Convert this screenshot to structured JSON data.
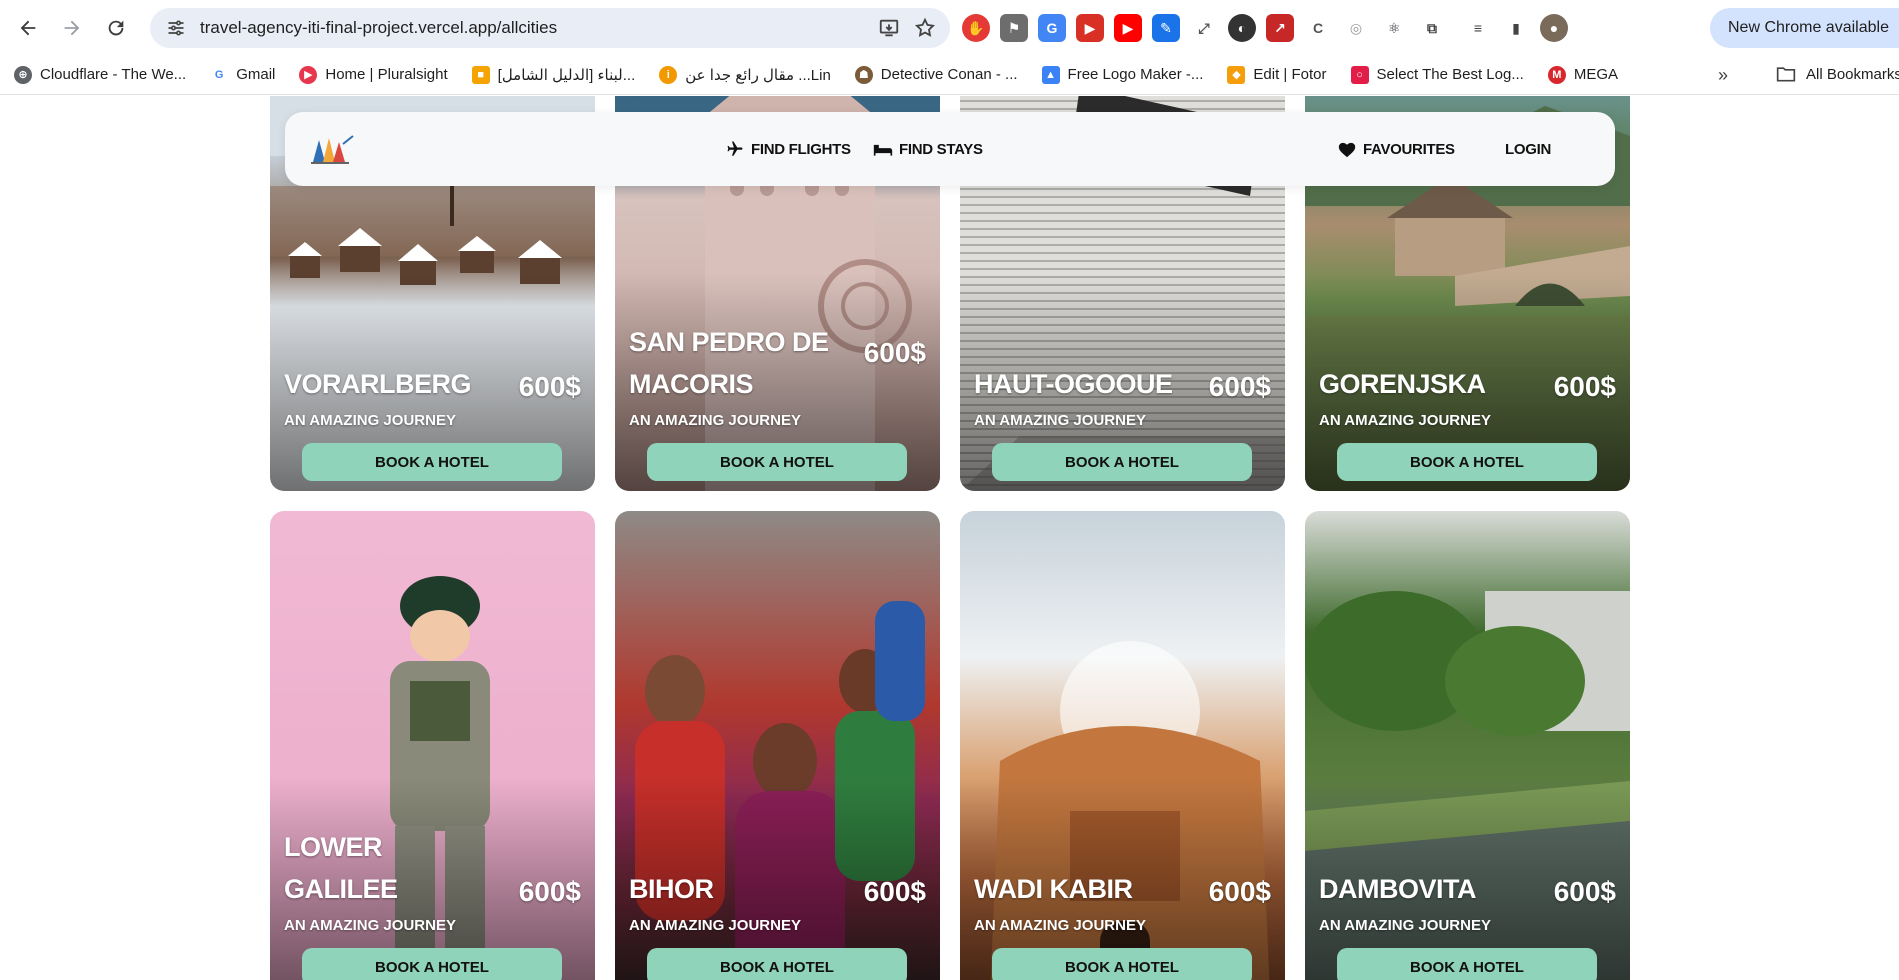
{
  "browser": {
    "url": "travel-agency-iti-final-project.vercel.app/allcities",
    "new_chrome_label": "New Chrome available",
    "bookmarks": [
      {
        "label": "Cloudflare - The We...",
        "color": "#5f6368"
      },
      {
        "label": "Gmail",
        "color": "#4285f4"
      },
      {
        "label": "Home | Pluralsight",
        "color": "#e8364f"
      },
      {
        "label": "[الدليل الشامل] لبناء...",
        "color": "#f4a300"
      },
      {
        "label": "مقال رائع جدا عن ...Lin",
        "color": "#f29900"
      },
      {
        "label": "Detective Conan - ...",
        "color": "#7b5b3a"
      },
      {
        "label": "Free Logo Maker -...",
        "color": "#3b82f6"
      },
      {
        "label": "Edit | Fotor",
        "color": "#f59e0b"
      },
      {
        "label": "Select The Best Log...",
        "color": "#e11d48"
      },
      {
        "label": "MEGA",
        "color": "#d9272e"
      }
    ],
    "more_bookmarks": "»",
    "all_bookmarks_label": "All Bookmarks"
  },
  "nav": {
    "flights": "Find Flights",
    "stays": "Find Stays",
    "favourites": "Favourites",
    "login": "Login"
  },
  "cards": [
    {
      "city": "Vorarlberg",
      "tagline": "An amazing journey",
      "price": "600$",
      "button": "Book a hotel"
    },
    {
      "city": "San Pedro de Macoris",
      "tagline": "An amazing journey",
      "price": "600$",
      "button": "Book a hotel"
    },
    {
      "city": "Haut-Ogooue",
      "tagline": "An amazing journey",
      "price": "600$",
      "button": "Book a hotel"
    },
    {
      "city": "Gorenjska",
      "tagline": "An amazing journey",
      "price": "600$",
      "button": "Book a hotel"
    },
    {
      "city": "Lower Galilee",
      "tagline": "An amazing journey",
      "price": "600$",
      "button": "Book a hotel"
    },
    {
      "city": "Bihor",
      "tagline": "An amazing journey",
      "price": "600$",
      "button": "Book a hotel"
    },
    {
      "city": "Wadi Kabir",
      "tagline": "An amazing journey",
      "price": "600$",
      "button": "Book a hotel"
    },
    {
      "city": "Dambovita",
      "tagline": "An amazing journey",
      "price": "600$",
      "button": "Book a hotel"
    }
  ]
}
